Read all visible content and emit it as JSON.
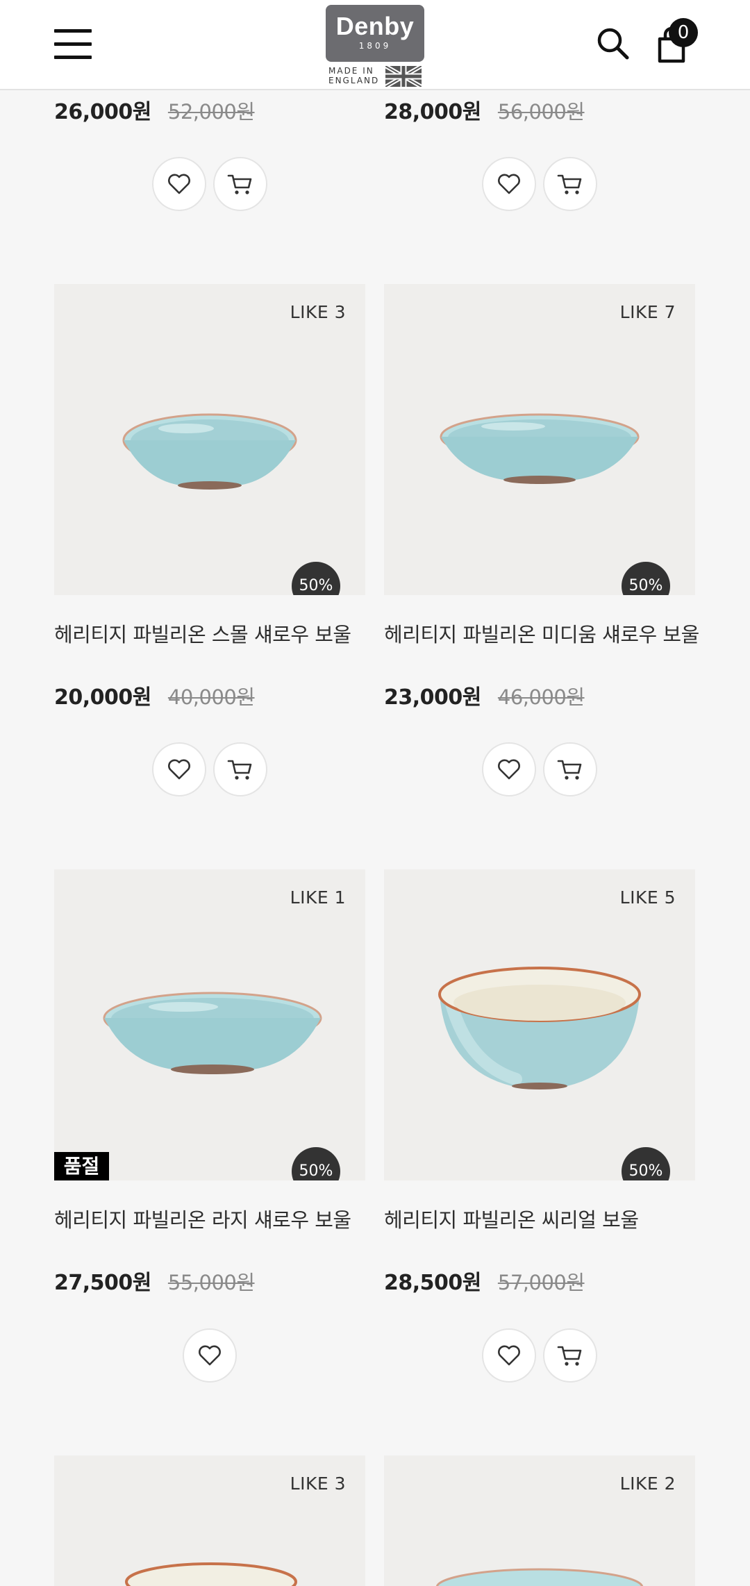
{
  "header": {
    "logo_brand": "Denby",
    "logo_year": "1809",
    "logo_made": "MADE IN ENGLAND",
    "cart_count": "0"
  },
  "products": [
    {
      "name": "",
      "price": "26,000원",
      "original_price": "52,000원",
      "like": "",
      "discount": ""
    },
    {
      "name": "",
      "price": "28,000원",
      "original_price": "56,000원",
      "like": "",
      "discount": ""
    },
    {
      "name": "헤리티지 파빌리온 스몰 섀로우 보울",
      "price": "20,000원",
      "original_price": "40,000원",
      "like": "LIKE 3",
      "discount": "50%"
    },
    {
      "name": "헤리티지 파빌리온 미디움 섀로우 보울",
      "price": "23,000원",
      "original_price": "46,000원",
      "like": "LIKE 7",
      "discount": "50%"
    },
    {
      "name": "헤리티지 파빌리온 라지 섀로우 보울",
      "price": "27,500원",
      "original_price": "55,000원",
      "like": "LIKE 1",
      "discount": "50%",
      "soldout": "품절"
    },
    {
      "name": "헤리티지 파빌리온 씨리얼 보울",
      "price": "28,500원",
      "original_price": "57,000원",
      "like": "LIKE 5",
      "discount": "50%"
    },
    {
      "like": "LIKE 3"
    },
    {
      "like": "LIKE 2"
    }
  ],
  "icons": {
    "menu": "hamburger-icon",
    "search": "search-icon",
    "cart": "bag-icon",
    "wishlist": "heart-icon",
    "add_to_cart": "cart-icon"
  },
  "colors": {
    "header_bg": "#ffffff",
    "page_bg": "#f6f6f6",
    "image_bg": "#efeeec",
    "badge": "#333333",
    "bowl_blue": "#a9d4d8",
    "rim_terracotta": "#c7724a"
  }
}
